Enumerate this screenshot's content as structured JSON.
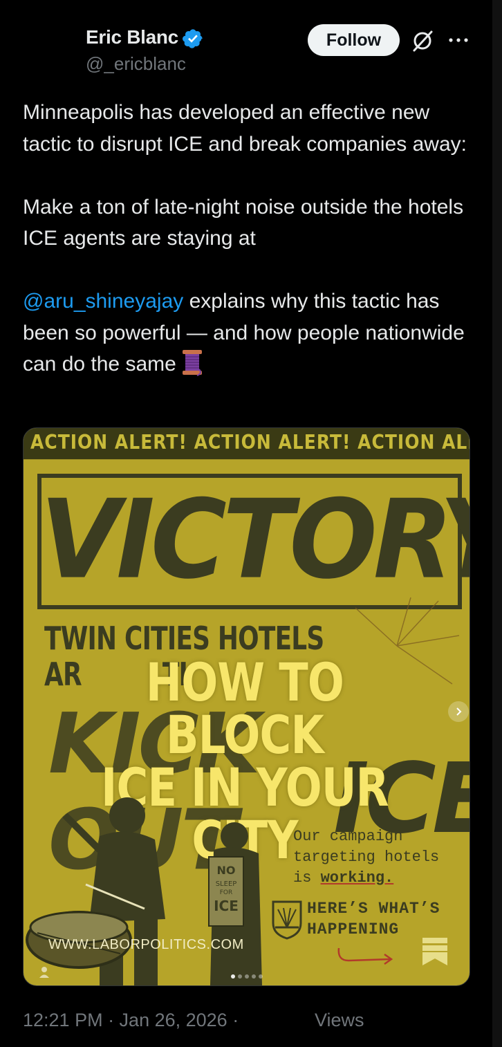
{
  "author": {
    "name": "Eric Blanc",
    "handle": "@_ericblanc",
    "verified": true
  },
  "header": {
    "follow_label": "Follow",
    "icons": [
      "verified-badge-icon",
      "grok-icon",
      "more-icon"
    ]
  },
  "tweet": {
    "paragraph1": "Minneapolis has developed an effective new tactic to disrupt ICE and break companies away:",
    "paragraph2": "Make a ton of late-night noise outside the hotels ICE agents are staying at",
    "mention": "@aru_shineyajay",
    "paragraph3_rest": " explains why this tactic has been so powerful — and how people nationwide can do the same",
    "emoji": "spool-of-thread"
  },
  "media": {
    "banner": "ACTION ALERT! ACTION ALERT! ACTION ALERT!",
    "victory": "VICTORY",
    "subhead_line1": "TWIN CITIES HOTELS",
    "subhead_line2": "AR",
    "subhead_line2b": "TI",
    "kick_word": "KICK OUT",
    "ice_word": "ICE",
    "headline_line1": "HOW TO BLOCK",
    "headline_line2": "ICE IN YOUR CITY",
    "campaign_line1": "Our campaign",
    "campaign_line2": "targeting hotels",
    "campaign_line3_pre": "is ",
    "campaign_line3_bold": "working.",
    "happening_line1": "HERE’S WHAT’S",
    "happening_line2": "HAPPENING",
    "sign_line1": "NO",
    "sign_line2": "SLEEP",
    "sign_line3": "FOR",
    "sign_line4": "ICE",
    "site_url": "WWW.LABORPOLITICS.COM",
    "image_count": 5,
    "current_image": 1
  },
  "footer": {
    "timestamp": "12:21 PM · Jan 26, 2026 ·",
    "views_label": "Views"
  },
  "colors": {
    "background": "#000000",
    "text": "#e7e9ea",
    "muted": "#71767b",
    "link": "#1d9bf0",
    "poster_yellow": "#b6a429",
    "poster_dark": "#3b3c20",
    "headline_yellow": "#f7e66b"
  }
}
